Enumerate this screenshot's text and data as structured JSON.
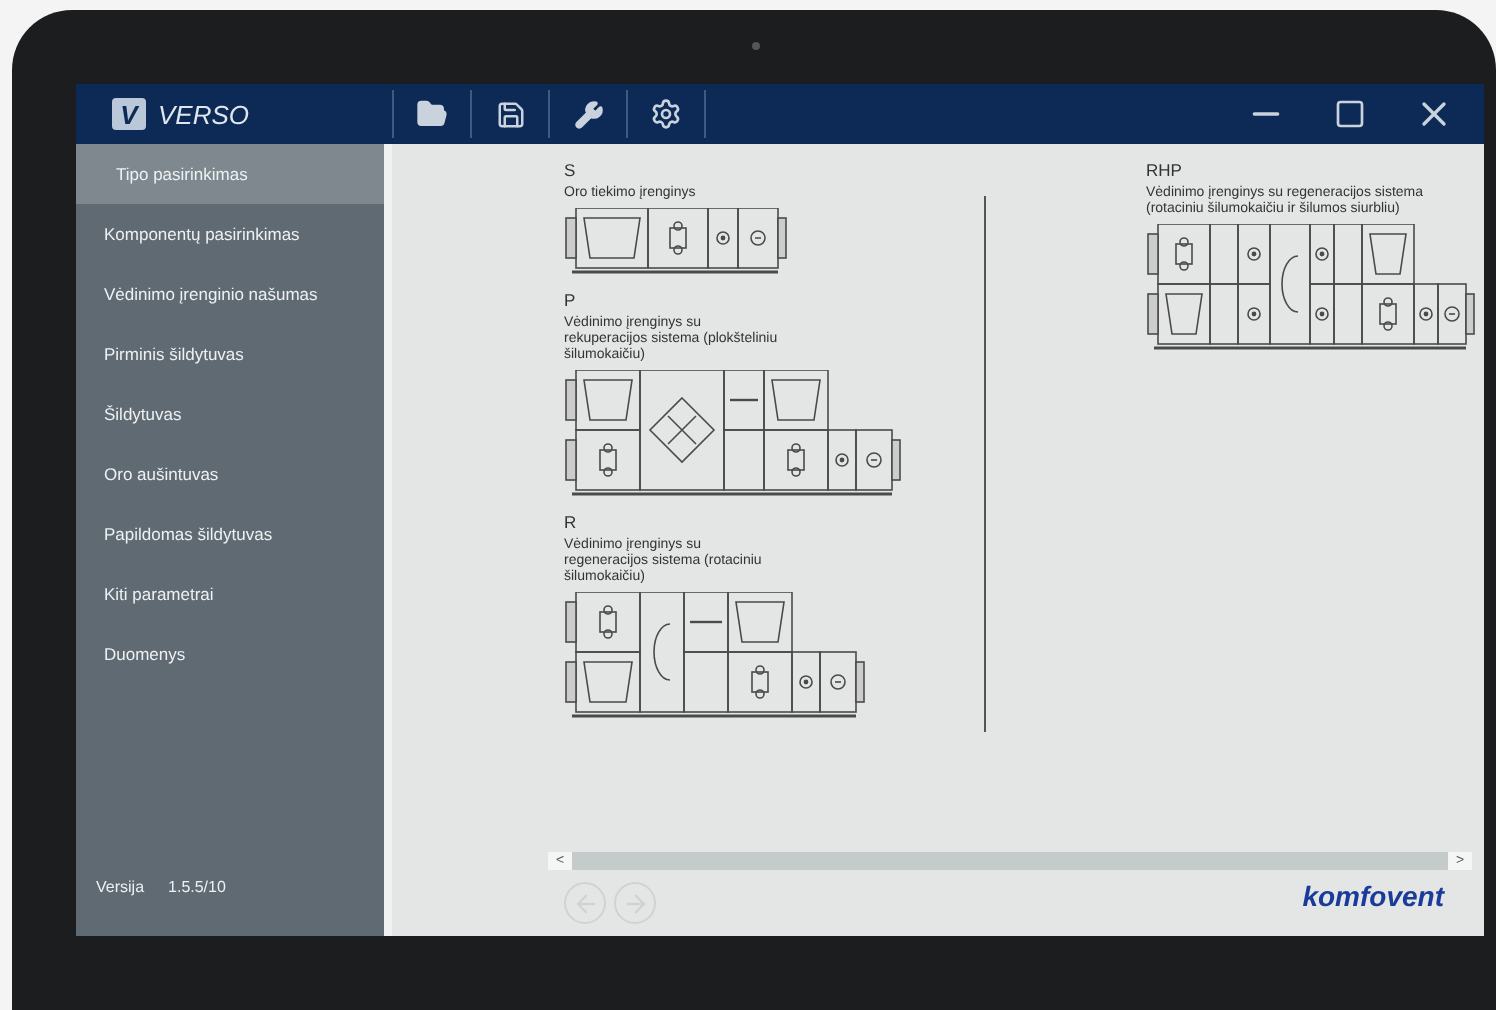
{
  "app": {
    "logo_mark": "V",
    "logo_name": "VERSO"
  },
  "sidebar": {
    "items": [
      {
        "label": "Tipo pasirinkimas",
        "selected": true
      },
      {
        "label": "Komponentų pasirinkimas",
        "selected": false
      },
      {
        "label": "Vėdinimo įrenginio našumas",
        "selected": false
      },
      {
        "label": "Pirminis šildytuvas",
        "selected": false
      },
      {
        "label": "Šildytuvas",
        "selected": false
      },
      {
        "label": "Oro aušintuvas",
        "selected": false
      },
      {
        "label": "Papildomas šildytuvas",
        "selected": false
      },
      {
        "label": "Kiti parametrai",
        "selected": false
      },
      {
        "label": "Duomenys",
        "selected": false
      }
    ],
    "version_label": "Versija",
    "version": "1.5.5/10"
  },
  "units_left": [
    {
      "code": "S",
      "description": "Oro tiekimo įrenginys",
      "kind": "supply"
    },
    {
      "code": "P",
      "description": "Vėdinimo įrenginys su rekuperacijos sistema (plokšteliniu šilumokaičiu)",
      "kind": "plate"
    },
    {
      "code": "R",
      "description": "Vėdinimo įrenginys su regeneracijos sistema (rotaciniu šilumokaičiu)",
      "kind": "rotary"
    }
  ],
  "units_right": [
    {
      "code": "RHP",
      "description": "Vėdinimo įrenginys su regeneracijos sistema (rotaciniu šilumokaičiu ir šilumos siurbliu)",
      "kind": "rotary_heat_pump"
    }
  ],
  "scrollbar": {
    "left": "<",
    "right": ">"
  },
  "navigation": {
    "back_disabled": true,
    "forward_disabled": true
  },
  "brand": "komfovent"
}
